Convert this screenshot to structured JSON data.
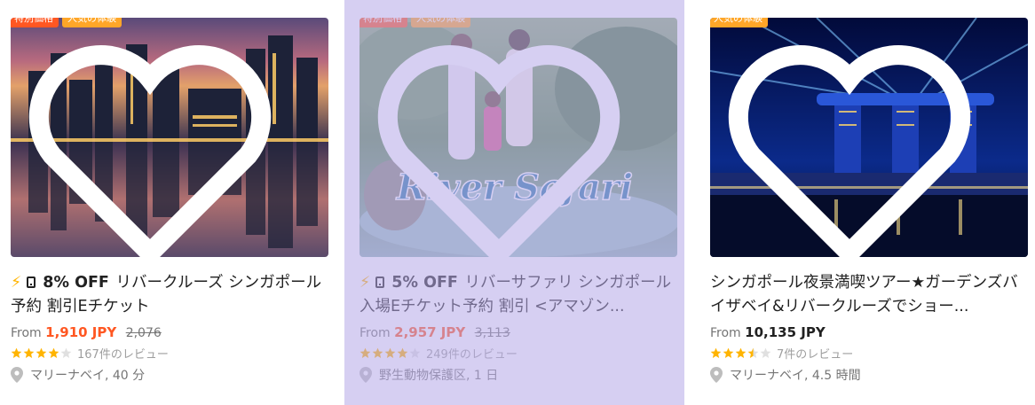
{
  "cards": [
    {
      "badges": [
        "特別価格",
        "人気の体験"
      ],
      "flash_icon": "⚡",
      "discount": "8% OFF",
      "title": "リバークルーズ シンガポール 予約 割引Eチケット",
      "price_prefix": "From",
      "price": "1,910 JPY",
      "old_price": "2,076",
      "rating": 4,
      "reviews": "167件のレビュー",
      "location": "マリーナベイ, 40 分",
      "icons": [
        "flash-icon",
        "mobile-ticket-icon",
        "heart-icon",
        "star-icon",
        "location-pin-icon"
      ]
    },
    {
      "badges": [
        "特別価格",
        "人気の体験"
      ],
      "flash_icon": "⚡",
      "discount": "5% OFF",
      "title": "リバーサファリ シンガポール 入場Eチケット予約 割引 <アマゾン...",
      "price_prefix": "From",
      "price": "2,957 JPY",
      "old_price": "3,113",
      "rating": 4,
      "reviews": "249件のレビュー",
      "location": "野生動物保護区, 1 日",
      "image_text": "River Safari",
      "highlighted": true
    },
    {
      "badges": [
        "人気の体験"
      ],
      "title": "シンガポール夜景満喫ツアー★ガーデンズバイザベイ&リバークルーズでショー...",
      "price_prefix": "From",
      "price": "10,135 JPY",
      "rating": 3.5,
      "reviews": "7件のレビュー",
      "location": "マリーナベイ, 4.5 時間"
    }
  ],
  "colors": {
    "orange_price": "#ff5722",
    "badge_red": "#ff5722",
    "badge_orange": "#ffa628",
    "star": "#ffb400",
    "highlight_overlay": "#b5a8e8"
  }
}
